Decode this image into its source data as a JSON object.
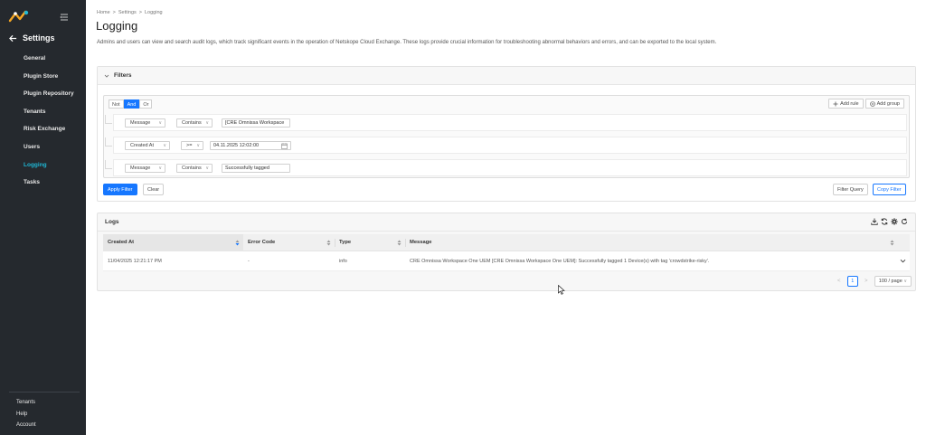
{
  "sidebar": {
    "back_title": "Settings",
    "items": [
      {
        "label": "General",
        "active": false
      },
      {
        "label": "Plugin Store",
        "active": false
      },
      {
        "label": "Plugin Repository",
        "active": false
      },
      {
        "label": "Tenants",
        "active": false
      },
      {
        "label": "Risk Exchange",
        "active": false
      },
      {
        "label": "Users",
        "active": false
      },
      {
        "label": "Logging",
        "active": true
      },
      {
        "label": "Tasks",
        "active": false
      }
    ],
    "bottom": [
      "Tenants",
      "Help",
      "Account"
    ],
    "accent": "#1fb6d4"
  },
  "breadcrumb": [
    "Home",
    ">",
    "Settings",
    ">",
    "Logging"
  ],
  "page": {
    "title": "Logging",
    "description": "Admins and users can view and search audit logs, which track significant events in the operation of Netskope Cloud Exchange. These logs provide crucial information for troubleshooting abnormal behaviors and errors, and can be exported to the local system."
  },
  "filters": {
    "title": "Filters",
    "conjunctions": [
      "Not",
      "And",
      "Or"
    ],
    "add_rule": "Add rule",
    "add_group": "Add group",
    "rules": [
      {
        "field": "Message",
        "operator": "Contains",
        "value": "[CRE Omnissa Workspace"
      },
      {
        "field": "Created At",
        "operator": ">=",
        "value": "04.11.2025 12:02:00"
      },
      {
        "field": "Message",
        "operator": "Contains",
        "value": "Successfully tagged"
      }
    ],
    "apply_label": "Apply Filter",
    "clear_label": "Clear",
    "filter_query_label": "Filter Query",
    "copy_filter_label": "Copy Filter"
  },
  "logs": {
    "title": "Logs",
    "columns": [
      "Created At",
      "Error Code",
      "Type",
      "Message"
    ],
    "rows": [
      {
        "created_at": "11/04/2025 12:21:17 PM",
        "error_code": "-",
        "type": "info",
        "message": "CRE Omnissa Workspace One UEM [CRE Omnissa Workspace One UEM]: Successfully tagged 1 Device(s) with tag 'crowdstrike-risky'."
      }
    ],
    "pagination": {
      "prev": "<",
      "page": "1",
      "next": ">",
      "page_size": "100 / page"
    }
  },
  "colors": {
    "primary": "#1677ff",
    "sidebar_bg": "#25292e"
  }
}
